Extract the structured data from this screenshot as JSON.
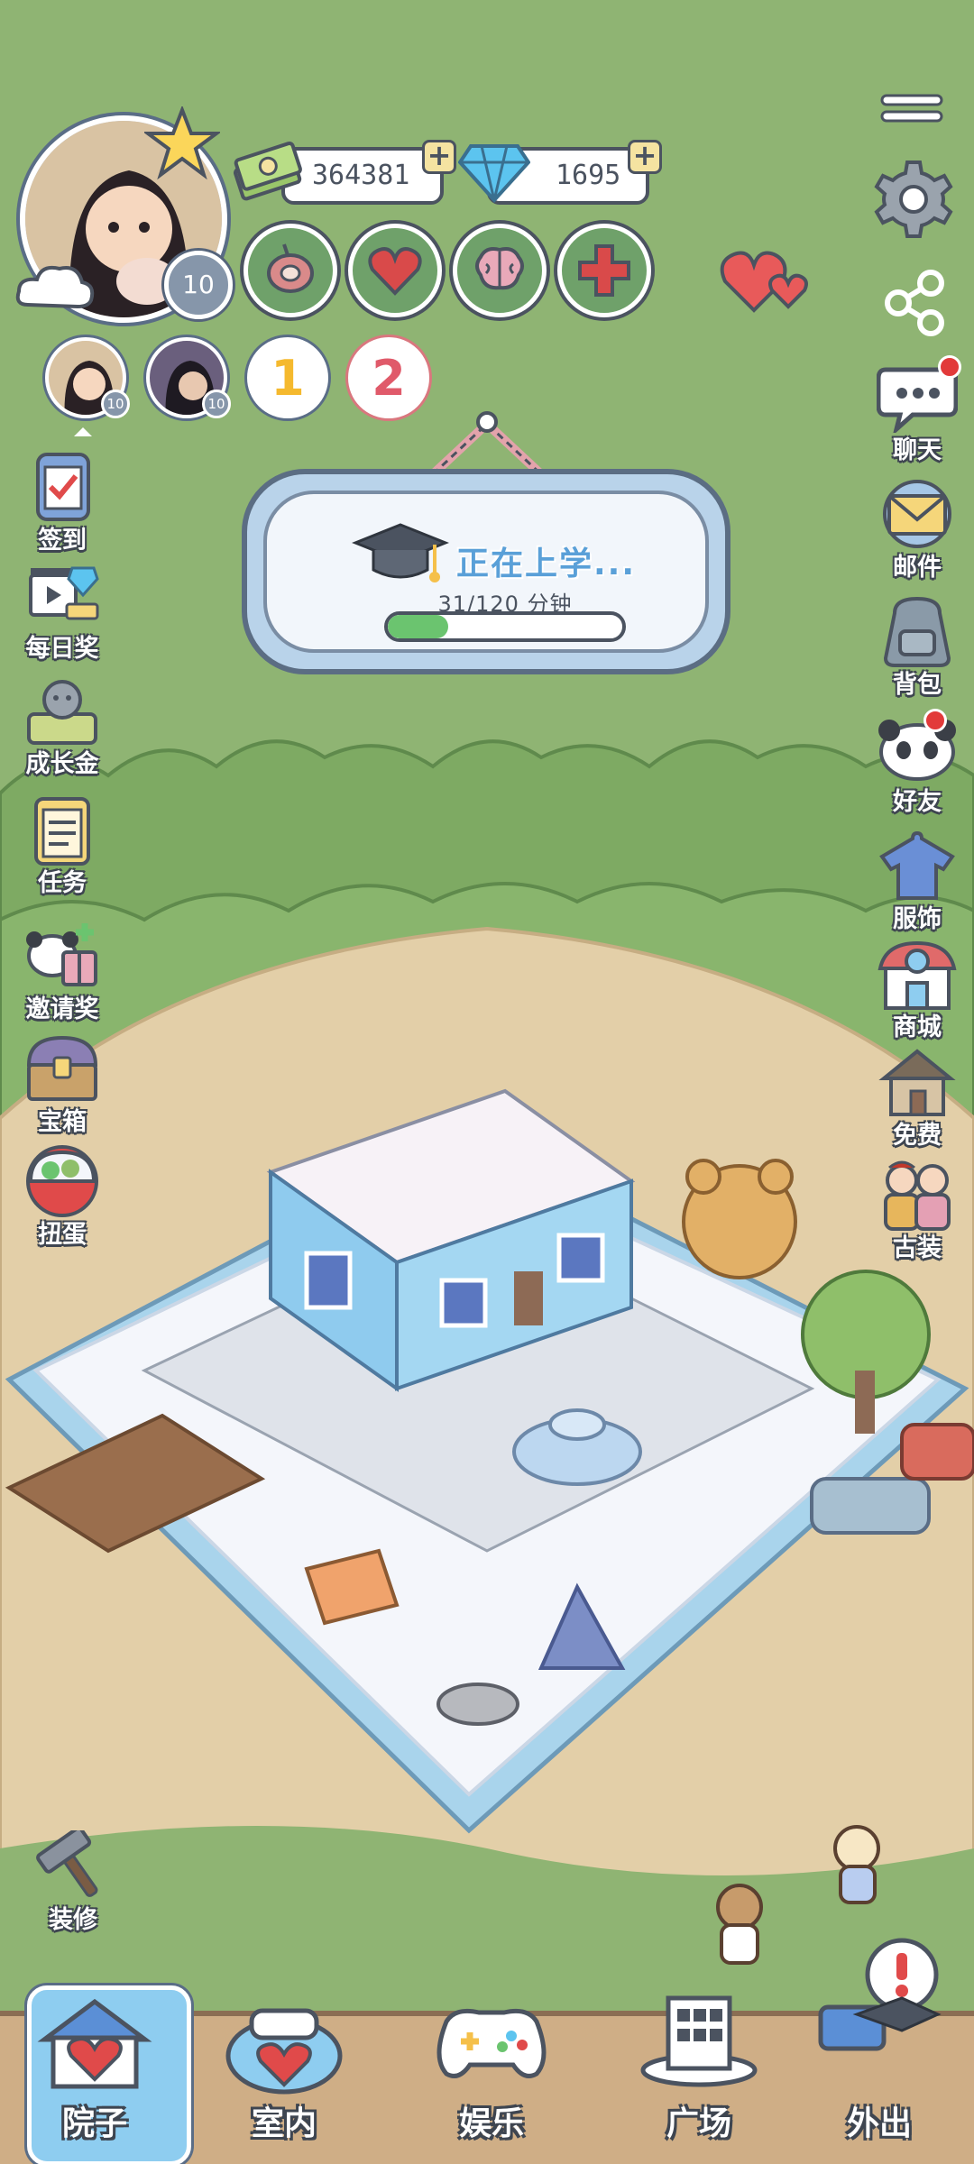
{
  "player": {
    "level": "10",
    "avatar_icon": "girl-with-cat-avatar"
  },
  "currency": {
    "cash": "364381",
    "diamonds": "1695",
    "add_symbol": "+"
  },
  "stats": [
    {
      "icon": "meat-icon"
    },
    {
      "icon": "heart-icon"
    },
    {
      "icon": "brain-icon"
    },
    {
      "icon": "health-cross-icon"
    }
  ],
  "friends": [
    {
      "type": "avatar",
      "level": "10"
    },
    {
      "type": "avatar",
      "level": "10"
    },
    {
      "type": "rank",
      "number": "1"
    },
    {
      "type": "rank",
      "number": "2"
    }
  ],
  "school": {
    "title": "正在上学...",
    "progress_text": "31/120 分钟",
    "progress_current": 31,
    "progress_total": 120
  },
  "left_menu": [
    {
      "label": "签到",
      "icon": "checkin-icon"
    },
    {
      "label": "每日奖",
      "icon": "daily-reward-icon"
    },
    {
      "label": "成长金",
      "icon": "growth-fund-icon"
    },
    {
      "label": "任务",
      "icon": "task-icon"
    },
    {
      "label": "邀请奖",
      "icon": "invite-reward-icon"
    },
    {
      "label": "宝箱",
      "icon": "treasure-chest-icon"
    },
    {
      "label": "扭蛋",
      "icon": "gacha-icon"
    }
  ],
  "right_menu": [
    {
      "label": "聊天",
      "icon": "chat-icon",
      "badge": true
    },
    {
      "label": "邮件",
      "icon": "mail-icon",
      "badge": false
    },
    {
      "label": "背包",
      "icon": "backpack-icon",
      "badge": false
    },
    {
      "label": "好友",
      "icon": "friends-icon",
      "badge": true
    },
    {
      "label": "服饰",
      "icon": "clothing-icon",
      "badge": false
    },
    {
      "label": "商城",
      "icon": "shop-icon",
      "badge": false
    },
    {
      "label": "免费",
      "icon": "free-house-icon",
      "badge": false
    },
    {
      "label": "古装",
      "icon": "ancient-costume-icon",
      "badge": false
    }
  ],
  "decorate": {
    "label": "装修"
  },
  "bottom_nav": [
    {
      "label": "院子",
      "icon": "yard-icon",
      "active": true
    },
    {
      "label": "室内",
      "icon": "indoor-icon",
      "active": false
    },
    {
      "label": "娱乐",
      "icon": "gamepad-icon",
      "active": false
    },
    {
      "label": "广场",
      "icon": "plaza-icon",
      "active": false
    },
    {
      "label": "外出",
      "icon": "go-out-icon",
      "active": false
    }
  ],
  "colors": {
    "background": "#8fb473",
    "accent_blue": "#8ecdf0",
    "progress_green": "#6bc46f",
    "badge_red": "#e23a3a"
  }
}
